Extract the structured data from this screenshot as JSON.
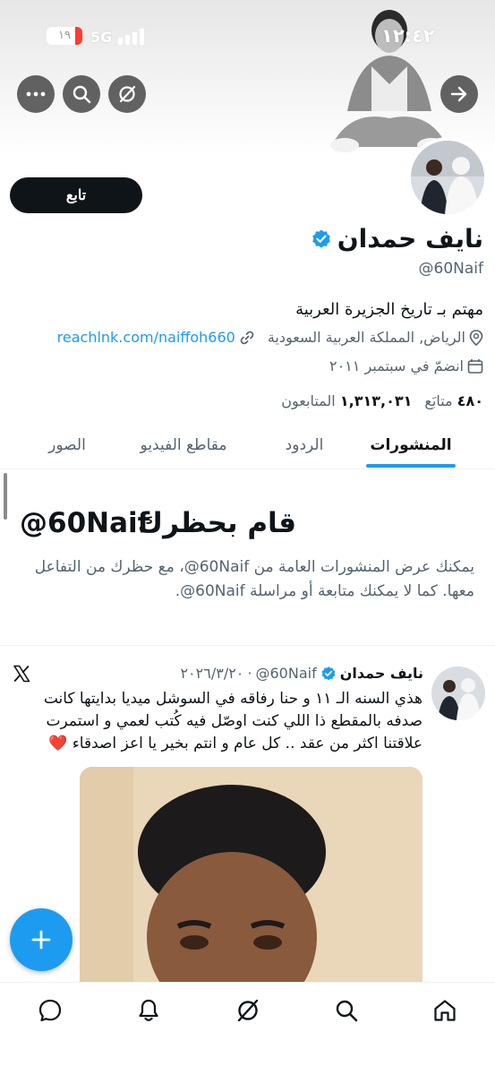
{
  "status_bar": {
    "battery": "١٩",
    "network": "5G",
    "time": "١٢:٤٢",
    "battery_color": "#ff3b30"
  },
  "header": {
    "actions": [
      {
        "icon": "more-icon"
      },
      {
        "icon": "search-icon"
      },
      {
        "icon": "grok-icon"
      }
    ],
    "back_icon": "arrow-forward-icon"
  },
  "profile": {
    "follow_label": "تابع",
    "name": "نايف حمدان",
    "verified": true,
    "handle": "@60Naif",
    "bio": "مهتم بـ تاريخ الجزيرة العربية",
    "location": "الرياض, المملكة العربية السعودية",
    "link": "reachlnk.com/naiffoh660",
    "joined": "انضمّ في سبتمبر ٢٠١١",
    "following_count": "٤٨٠",
    "following_label": "متابَع",
    "followers_count": "١,٣١٣,٠٣١",
    "followers_label": "المتابعون"
  },
  "tabs": [
    {
      "label": "المنشورات",
      "active": true
    },
    {
      "label": "الردود",
      "active": false
    },
    {
      "label": "مقاطع الفيديو",
      "active": false
    },
    {
      "label": "الصور",
      "active": false
    }
  ],
  "blocked": {
    "title": "قام بحظرك",
    "handle": "@60Naif",
    "description": "يمكنك عرض المنشورات العامة من ‎@60Naif‏، مع حظرك من التفاعل معها. كما لا يمكنك متابعة أو مراسلة ‎@60Naif‏."
  },
  "tweet": {
    "name": "نايف حمدان",
    "handle": "@60Naif",
    "date": "٢٠٢٦/٣/٢٠",
    "separator": "·",
    "text": "هذي السنه الـ ١١ و حنا رفاقه في السوشل ميديا بدايتها كانت صدفه بالمقطع ذا اللي كنت اوصّل فيه كُتب لعمي و استمرت علاقتنا اكثر من عقد .. كل عام و انتم بخير يا اعز اصدقاء ❤️"
  },
  "fab_icon": "plus-icon",
  "bottom_nav": [
    {
      "icon": "messages-icon"
    },
    {
      "icon": "notifications-icon"
    },
    {
      "icon": "grok-icon"
    },
    {
      "icon": "search-icon"
    },
    {
      "icon": "home-icon"
    }
  ],
  "colors": {
    "accent": "#1d9bf0",
    "text": "#0f1419",
    "secondary_text": "#536471",
    "verified": "#1d9bf0"
  }
}
